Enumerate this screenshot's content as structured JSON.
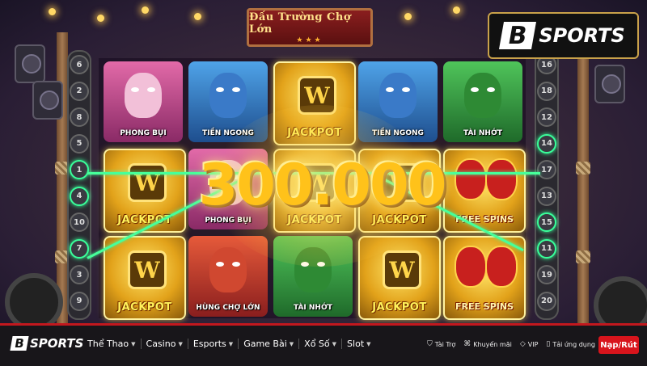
{
  "game": {
    "sign_title": "Đấu Trường Chợ Lớn",
    "sign_stars": "★★★",
    "win_amount": "300.000",
    "left_paylines": [
      "6",
      "2",
      "8",
      "5",
      "1",
      "4",
      "10",
      "7",
      "3",
      "9"
    ],
    "right_paylines": [
      "16",
      "18",
      "12",
      "14",
      "17",
      "13",
      "15",
      "11",
      "19",
      "20"
    ],
    "active_left": [
      "1",
      "4",
      "7"
    ],
    "active_right": [
      "14",
      "15",
      "11"
    ],
    "symbols": {
      "phong_bui": "PHONG BỤI",
      "tien_ngong": "TIỀN NGONG",
      "tai_nhot": "TÀI NHỚT",
      "hung_cho_lon": "HÙNG CHỢ LỚN",
      "jackpot": "JACKPOT",
      "free_spins": "FREE SPINS",
      "w": "W"
    }
  },
  "brand": {
    "letter": "B",
    "name": "SPORTS"
  },
  "nav": {
    "items": [
      "Thể Thao",
      "Casino",
      "Esports",
      "Game Bài",
      "Xổ Số",
      "Slot"
    ],
    "links": [
      "Tài Trợ",
      "Khuyến mãi",
      "VIP",
      "Tải ứng dụng"
    ],
    "cta": "Nạp/Rút"
  },
  "colors": {
    "accent": "#d8141c",
    "win_line": "#46ff9a",
    "gold": "#ffc21a"
  }
}
